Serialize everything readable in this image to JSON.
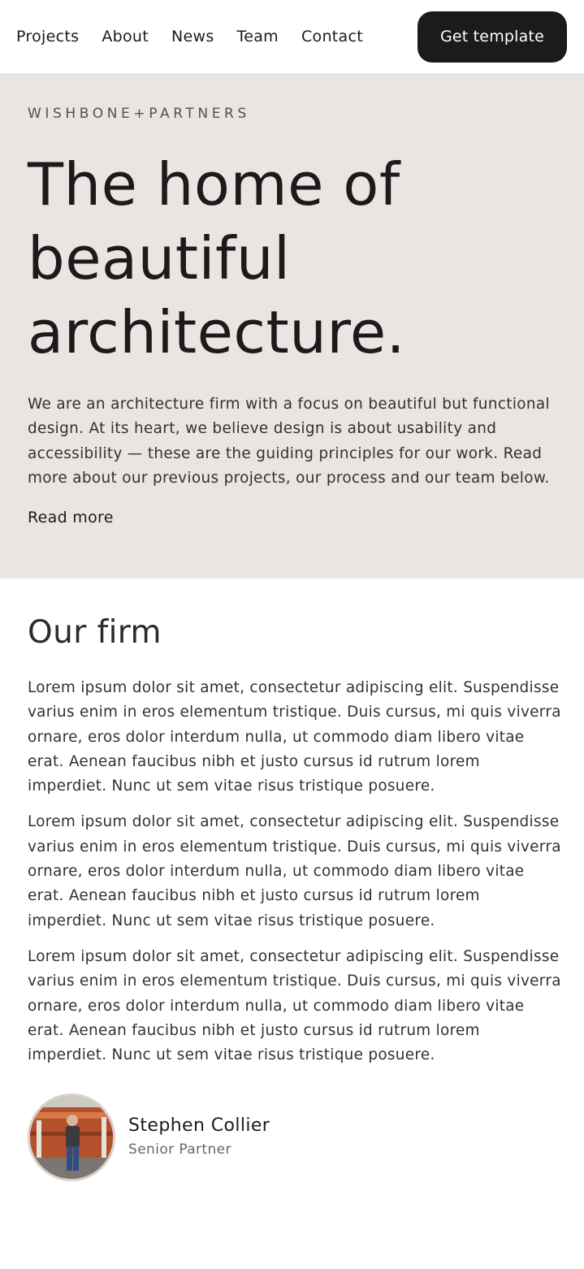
{
  "nav": {
    "links": [
      "Projects",
      "About",
      "News",
      "Team",
      "Contact"
    ],
    "cta_label": "Get template"
  },
  "hero": {
    "eyebrow": "WISHBONE+PARTNERS",
    "heading": "The home of beautiful architecture.",
    "text": "We are an architecture firm with a focus on beautiful but functional design. At its heart, we believe design is about usability and accessibility — these are the guiding principles for our work. Read more about our previous projects, our process and our team below.",
    "read_more": "Read more"
  },
  "firm": {
    "heading": "Our firm",
    "paragraphs": [
      "Lorem ipsum dolor sit amet, consectetur adipiscing elit. Suspendisse varius enim in eros elementum tristique. Duis cursus, mi quis viverra ornare, eros dolor interdum nulla, ut commodo diam libero vitae erat. Aenean faucibus nibh et justo cursus id rutrum lorem imperdiet. Nunc ut sem vitae risus tristique posuere.",
      "Lorem ipsum dolor sit amet, consectetur adipiscing elit. Suspendisse varius enim in eros elementum tristique. Duis cursus, mi quis viverra ornare, eros dolor interdum nulla, ut commodo diam libero vitae erat. Aenean faucibus nibh et justo cursus id rutrum lorem imperdiet. Nunc ut sem vitae risus tristique posuere.",
      "Lorem ipsum dolor sit amet, consectetur adipiscing elit. Suspendisse varius enim in eros elementum tristique. Duis cursus, mi quis viverra ornare, eros dolor interdum nulla, ut commodo diam libero vitae erat. Aenean faucibus nibh et justo cursus id rutrum lorem imperdiet. Nunc ut sem vitae risus tristique posuere."
    ],
    "person": {
      "name": "Stephen Collier",
      "role": "Senior Partner"
    }
  },
  "colors": {
    "hero_background": "#eae5e2",
    "cta_background": "#1b1b1b",
    "cta_text": "#ffffff",
    "text_primary": "#1b1b1b"
  }
}
